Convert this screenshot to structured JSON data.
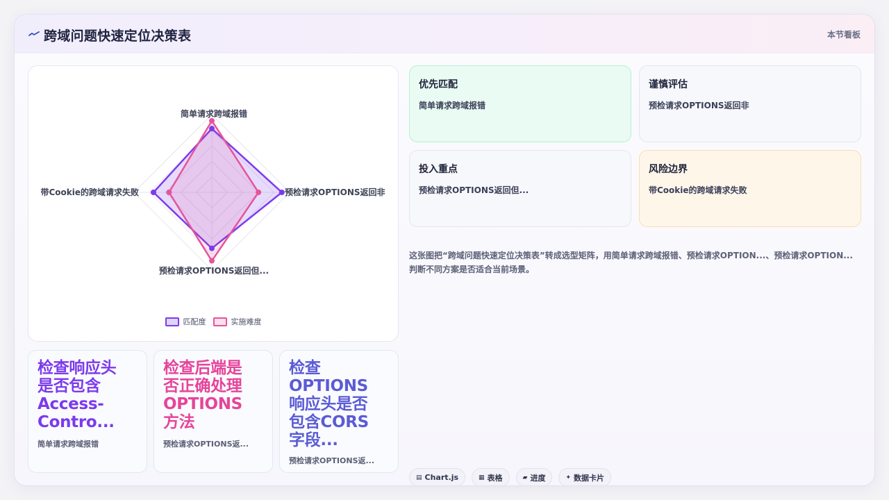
{
  "header": {
    "title": "跨域问题快速定位决策表",
    "right_label": "本节看板",
    "icon": "zigzag-icon"
  },
  "chart_data": {
    "type": "radar",
    "axes": [
      "简单请求跨域报错",
      "预检请求OPTIONS返回非",
      "预检请求OPTIONS返回但...",
      "带Cookie的跨域请求失败"
    ],
    "series": [
      {
        "name": "匹配度",
        "values": [
          82,
          90,
          72,
          75
        ],
        "color": "#7c3aed"
      },
      {
        "name": "实施难度",
        "values": [
          92,
          60,
          88,
          55
        ],
        "color": "#e6549a"
      }
    ],
    "rmax": 100
  },
  "quadrants": [
    {
      "title": "优先匹配",
      "text": "简单请求跨域报错",
      "style": "green"
    },
    {
      "title": "谨慎评估",
      "text": "预检请求OPTIONS返回非",
      "style": "plain"
    },
    {
      "title": "投入重点",
      "text": "预检请求OPTIONS返回但...",
      "style": "plain"
    },
    {
      "title": "风险边界",
      "text": "带Cookie的跨域请求失败",
      "style": "orange"
    }
  ],
  "description": "这张图把“跨域问题快速定位决策表”转成选型矩阵，用简单请求跨域报错、预检请求OPTION...、预检请求OPTION...判断不同方案是否适合当前场景。",
  "minis": [
    {
      "title_lines": [
        "检查响应头",
        "是否包含",
        "Access-",
        "Contro..."
      ],
      "subtitle": "简单请求跨域报错",
      "color": "#7c3aed"
    },
    {
      "title_lines": [
        "检查后端是",
        "否正确处理",
        "OPTIONS",
        "方法"
      ],
      "subtitle": "预检请求OPTIONS返...",
      "color": "#e6449a"
    },
    {
      "title_lines": [
        "检查",
        "OPTIONS",
        "响应头是否",
        "包含CORS",
        "字段..."
      ],
      "subtitle": "预检请求OPTIONS返...",
      "color": "#5b5bd6"
    }
  ],
  "tags": [
    {
      "icon": "▤",
      "label": "Chart.js"
    },
    {
      "icon": "▦",
      "label": "表格"
    },
    {
      "icon": "▰",
      "label": "进度"
    },
    {
      "icon": "✦",
      "label": "数据卡片"
    }
  ]
}
